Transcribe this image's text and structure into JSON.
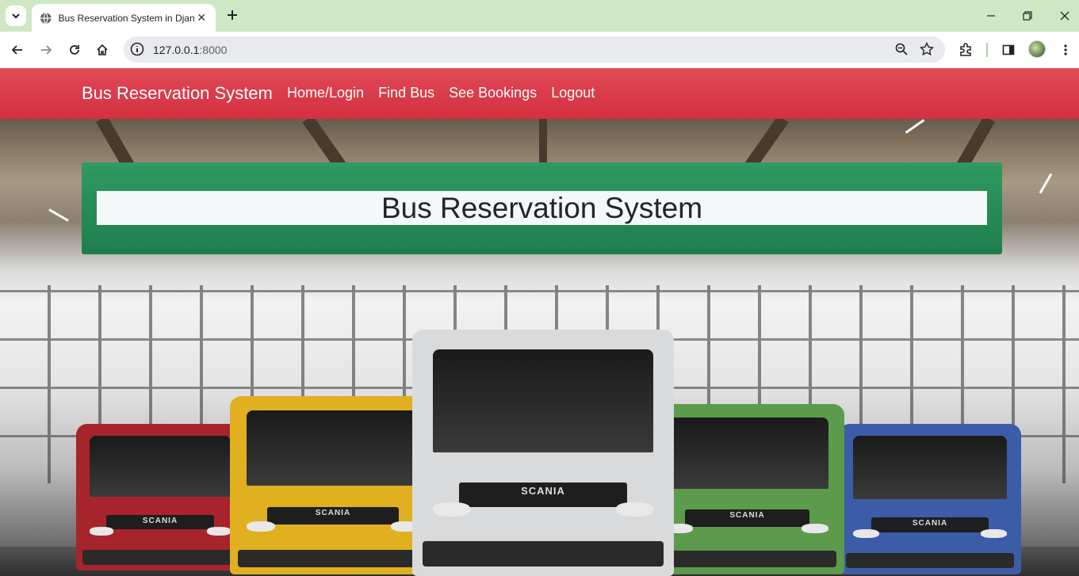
{
  "browser": {
    "tab_title": "Bus Reservation System in Djan",
    "url_host": "127.0.0.1",
    "url_port": ":8000"
  },
  "navbar": {
    "brand": "Bus Reservation System",
    "links": [
      "Home/Login",
      "Find Bus",
      "See Bookings",
      "Logout"
    ]
  },
  "banner": {
    "title": "Bus Reservation System"
  },
  "hero": {
    "bus_brand": "SCANIA",
    "bus_colors": [
      "#a8242c",
      "#e0b020",
      "#d8dadc",
      "#5c9a4c",
      "#3c5ca8"
    ]
  },
  "colors": {
    "navbar": "#dc3545",
    "banner": "#198754",
    "tabstrip": "#cfe8c4"
  }
}
